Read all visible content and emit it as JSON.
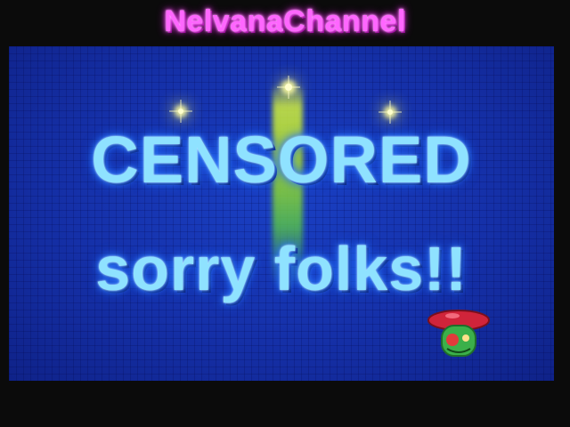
{
  "channel": {
    "title": "NelvanaChannel"
  },
  "screen": {
    "line1": "CENSORED",
    "line2": "sorry folks!!"
  },
  "colors": {
    "channel_title": "#ff66ff",
    "screen_background": "#1530a8",
    "message_text": "#8fe2ff",
    "frame": "#0b0b0b"
  },
  "icons": {
    "sparkles": "sparkle-icon",
    "mascot": "mushroom-character-icon"
  }
}
